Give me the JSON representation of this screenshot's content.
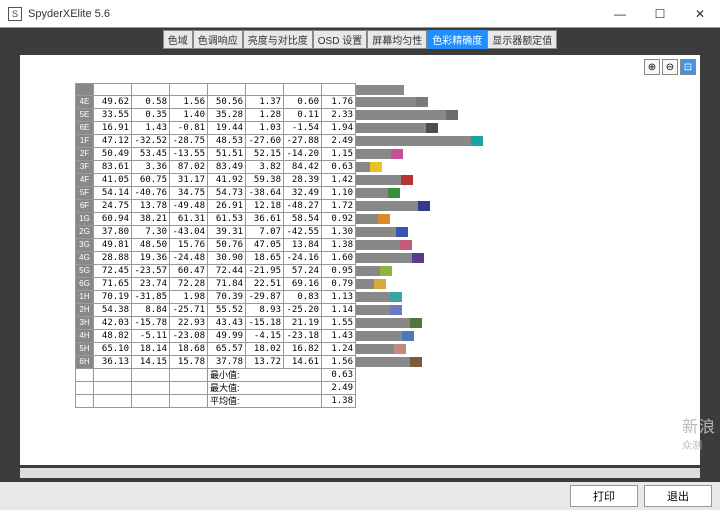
{
  "window": {
    "title": "SpyderXElite 5.6"
  },
  "tabs": [
    {
      "label": "色域",
      "active": false
    },
    {
      "label": "色调响应",
      "active": false
    },
    {
      "label": "亮度与对比度",
      "active": false
    },
    {
      "label": "OSD 设置",
      "active": false
    },
    {
      "label": "屏幕均匀性",
      "active": false
    },
    {
      "label": "色彩精确度",
      "active": true
    },
    {
      "label": "显示器额定值",
      "active": false
    }
  ],
  "rows": [
    {
      "id": "4E",
      "c1": "49.62",
      "c2": "0.58",
      "c3": "1.56",
      "c4": "50.56",
      "c5": "1.37",
      "c6": "0.60",
      "de": "1.76",
      "color": "#7a7a7a"
    },
    {
      "id": "5E",
      "c1": "33.55",
      "c2": "0.35",
      "c3": "1.40",
      "c4": "35.28",
      "c5": "1.28",
      "c6": "0.11",
      "de": "2.33",
      "bar": 90,
      "color": "#6e6e6e"
    },
    {
      "id": "6E",
      "c1": "16.91",
      "c2": "1.43",
      "c3": "-0.81",
      "c4": "19.44",
      "c5": "1.03",
      "c6": "-1.54",
      "de": "1.94",
      "bar": 70,
      "color": "#4d4d4d"
    },
    {
      "id": "1F",
      "c1": "47.12",
      "c2": "-32.52",
      "c3": "-28.75",
      "c4": "48.53",
      "c5": "-27.60",
      "c6": "-27.88",
      "de": "2.49",
      "bar": 115,
      "color": "#1aa3a3"
    },
    {
      "id": "2F",
      "c1": "50.49",
      "c2": "53.45",
      "c3": "-13.55",
      "c4": "51.51",
      "c5": "52.15",
      "c6": "-14.20",
      "de": "1.15",
      "bar": 35,
      "color": "#c94f9b"
    },
    {
      "id": "3F",
      "c1": "83.61",
      "c2": "3.36",
      "c3": "87.02",
      "c4": "83.49",
      "c5": "3.82",
      "c6": "84.42",
      "de": "0.63",
      "bar": 14,
      "color": "#e8c227"
    },
    {
      "id": "4F",
      "c1": "41.05",
      "c2": "60.75",
      "c3": "31.17",
      "c4": "41.92",
      "c5": "59.38",
      "c6": "28.39",
      "de": "1.42",
      "bar": 45,
      "color": "#b43535"
    },
    {
      "id": "5F",
      "c1": "54.14",
      "c2": "-40.76",
      "c3": "34.75",
      "c4": "54.73",
      "c5": "-38.64",
      "c6": "32.49",
      "de": "1.10",
      "bar": 32,
      "color": "#3a8f3a"
    },
    {
      "id": "6F",
      "c1": "24.75",
      "c2": "13.78",
      "c3": "-49.48",
      "c4": "26.91",
      "c5": "12.18",
      "c6": "-48.27",
      "de": "1.72",
      "bar": 62,
      "color": "#2f3a8f"
    },
    {
      "id": "1G",
      "c1": "60.94",
      "c2": "38.21",
      "c3": "61.31",
      "c4": "61.53",
      "c5": "36.61",
      "c6": "58.54",
      "de": "0.92",
      "bar": 22,
      "color": "#d98a2f"
    },
    {
      "id": "2G",
      "c1": "37.80",
      "c2": "7.30",
      "c3": "-43.04",
      "c4": "39.31",
      "c5": "7.07",
      "c6": "-42.55",
      "de": "1.30",
      "bar": 40,
      "color": "#3a52b0"
    },
    {
      "id": "3G",
      "c1": "49.81",
      "c2": "48.50",
      "c3": "15.76",
      "c4": "50.76",
      "c5": "47.05",
      "c6": "13.84",
      "de": "1.38",
      "bar": 44,
      "color": "#c25a7a"
    },
    {
      "id": "4G",
      "c1": "28.88",
      "c2": "19.36",
      "c3": "-24.48",
      "c4": "30.90",
      "c5": "18.65",
      "c6": "-24.16",
      "de": "1.60",
      "bar": 56,
      "color": "#5a3a8f"
    },
    {
      "id": "5G",
      "c1": "72.45",
      "c2": "-23.57",
      "c3": "60.47",
      "c4": "72.44",
      "c5": "-21.95",
      "c6": "57.24",
      "de": "0.95",
      "bar": 24,
      "color": "#8fb53a"
    },
    {
      "id": "6G",
      "c1": "71.65",
      "c2": "23.74",
      "c3": "72.28",
      "c4": "71.84",
      "c5": "22.51",
      "c6": "69.16",
      "de": "0.79",
      "bar": 18,
      "color": "#d9a83a"
    },
    {
      "id": "1H",
      "c1": "70.19",
      "c2": "-31.85",
      "c3": "1.98",
      "c4": "70.39",
      "c5": "-29.87",
      "c6": "0.83",
      "de": "1.13",
      "bar": 34,
      "color": "#3aa3a3"
    },
    {
      "id": "2H",
      "c1": "54.38",
      "c2": "8.84",
      "c3": "-25.71",
      "c4": "55.52",
      "c5": "8.93",
      "c6": "-25.20",
      "de": "1.14",
      "bar": 34,
      "color": "#6a7ac2"
    },
    {
      "id": "3H",
      "c1": "42.03",
      "c2": "-15.78",
      "c3": "22.93",
      "c4": "43.43",
      "c5": "-15.18",
      "c6": "21.19",
      "de": "1.55",
      "bar": 54,
      "color": "#4d7a3a"
    },
    {
      "id": "4H",
      "c1": "48.82",
      "c2": "-5.11",
      "c3": "-23.08",
      "c4": "49.99",
      "c5": "-4.15",
      "c6": "-23.18",
      "de": "1.43",
      "bar": 46,
      "color": "#4a7ab5"
    },
    {
      "id": "5H",
      "c1": "65.10",
      "c2": "18.14",
      "c3": "18.68",
      "c4": "65.57",
      "c5": "18.02",
      "c6": "16.82",
      "de": "1.24",
      "bar": 38,
      "color": "#c28a7a"
    },
    {
      "id": "6H",
      "c1": "36.13",
      "c2": "14.15",
      "c3": "15.78",
      "c4": "37.78",
      "c5": "13.72",
      "c6": "14.61",
      "de": "1.56",
      "bar": 54,
      "color": "#7a5a3a"
    }
  ],
  "summary": [
    {
      "label": "最小值:",
      "value": "0.63"
    },
    {
      "label": "最大值:",
      "value": "2.49"
    },
    {
      "label": "平均值:",
      "value": "1.38"
    }
  ],
  "footer": {
    "print": "打印",
    "exit": "退出"
  },
  "watermark": {
    "main": "新浪",
    "sub": "众测"
  }
}
